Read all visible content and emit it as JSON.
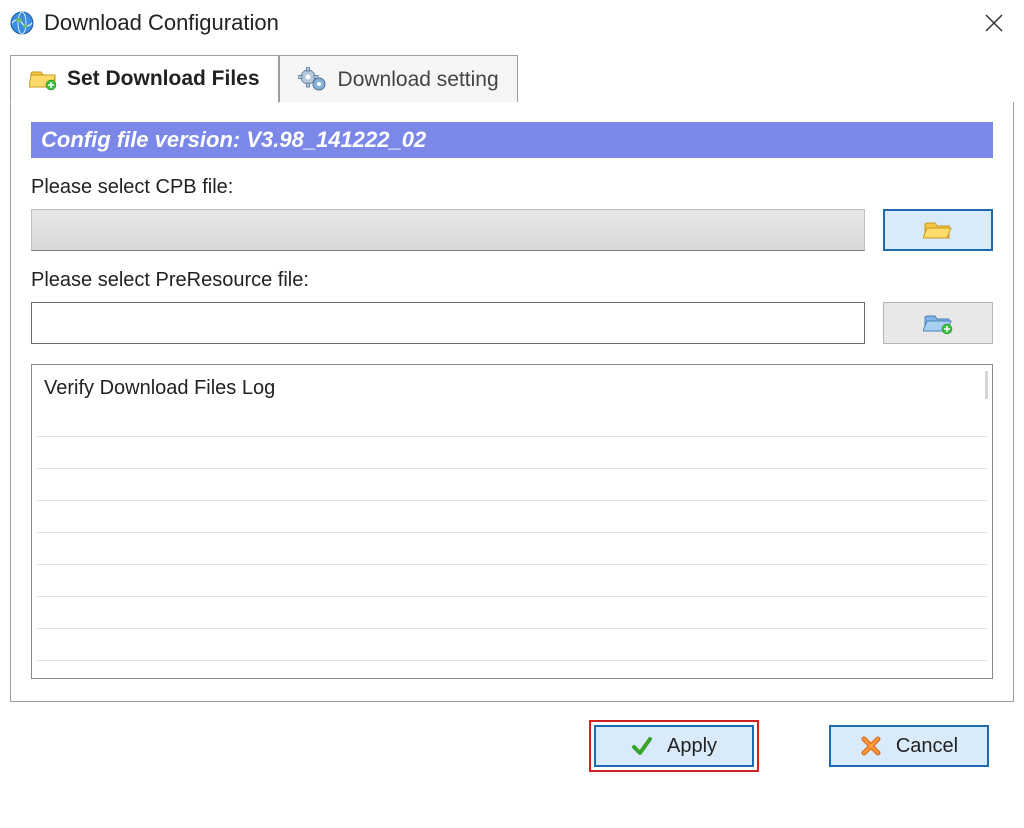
{
  "window": {
    "title": "Download Configuration"
  },
  "tabs": {
    "set_files": {
      "label": "Set Download Files"
    },
    "download_setting": {
      "label": "Download setting"
    }
  },
  "banner": {
    "text": "Config file version: V3.98_141222_02"
  },
  "form": {
    "cpb_label": "Please select CPB file:",
    "cpb_value": "",
    "preresource_label": "Please select PreResource file:",
    "preresource_value": ""
  },
  "log": {
    "header": "Verify Download Files Log"
  },
  "buttons": {
    "apply": "Apply",
    "cancel": "Cancel"
  }
}
